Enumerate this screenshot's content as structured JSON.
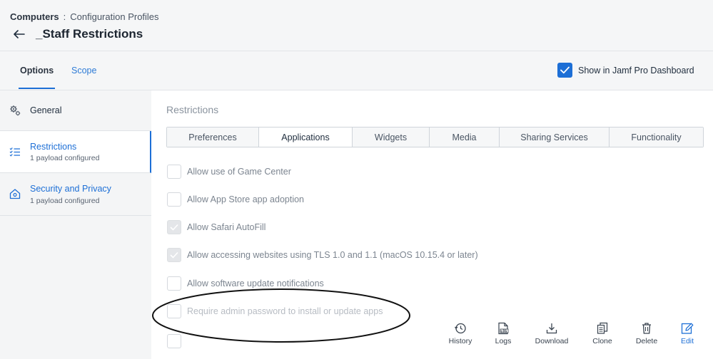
{
  "breadcrumb": {
    "root": "Computers",
    "separator": ":",
    "current": "Configuration Profiles"
  },
  "page": {
    "title": "_Staff Restrictions"
  },
  "tabs": [
    {
      "label": "Options"
    },
    {
      "label": "Scope"
    }
  ],
  "dashboard_toggle": {
    "label": "Show in Jamf Pro Dashboard",
    "checked": true
  },
  "sidebar": {
    "items": [
      {
        "label": "General",
        "sub": "",
        "icon": "gear-icon"
      },
      {
        "label": "Restrictions",
        "sub": "1 payload configured",
        "icon": "checklist-icon"
      },
      {
        "label": "Security and Privacy",
        "sub": "1 payload configured",
        "icon": "house-shield-icon"
      }
    ]
  },
  "main": {
    "section_title": "Restrictions",
    "subtabs": [
      "Preferences",
      "Applications",
      "Widgets",
      "Media",
      "Sharing Services",
      "Functionality"
    ],
    "active_subtab": "Applications",
    "options": [
      {
        "label": "Allow use of Game Center",
        "checked": false
      },
      {
        "label": "Allow App Store app adoption",
        "checked": false
      },
      {
        "label": "Allow Safari AutoFill",
        "checked": true
      },
      {
        "label": "Allow accessing websites using TLS 1.0 and 1.1 (macOS 10.15.4 or later)",
        "checked": true
      },
      {
        "label": "Allow software update notifications",
        "checked": false
      },
      {
        "label": "Require admin password to install or update apps",
        "checked": false
      }
    ]
  },
  "actions": [
    {
      "label": "History",
      "icon": "history-icon"
    },
    {
      "label": "Logs",
      "icon": "logs-icon"
    },
    {
      "label": "Download",
      "icon": "download-icon"
    },
    {
      "label": "Clone",
      "icon": "clone-icon"
    },
    {
      "label": "Delete",
      "icon": "trash-icon"
    },
    {
      "label": "Edit",
      "icon": "edit-icon"
    }
  ],
  "colors": {
    "accent": "#1d6fd6",
    "text": "#1f2d3d",
    "muted": "#7c8590"
  }
}
